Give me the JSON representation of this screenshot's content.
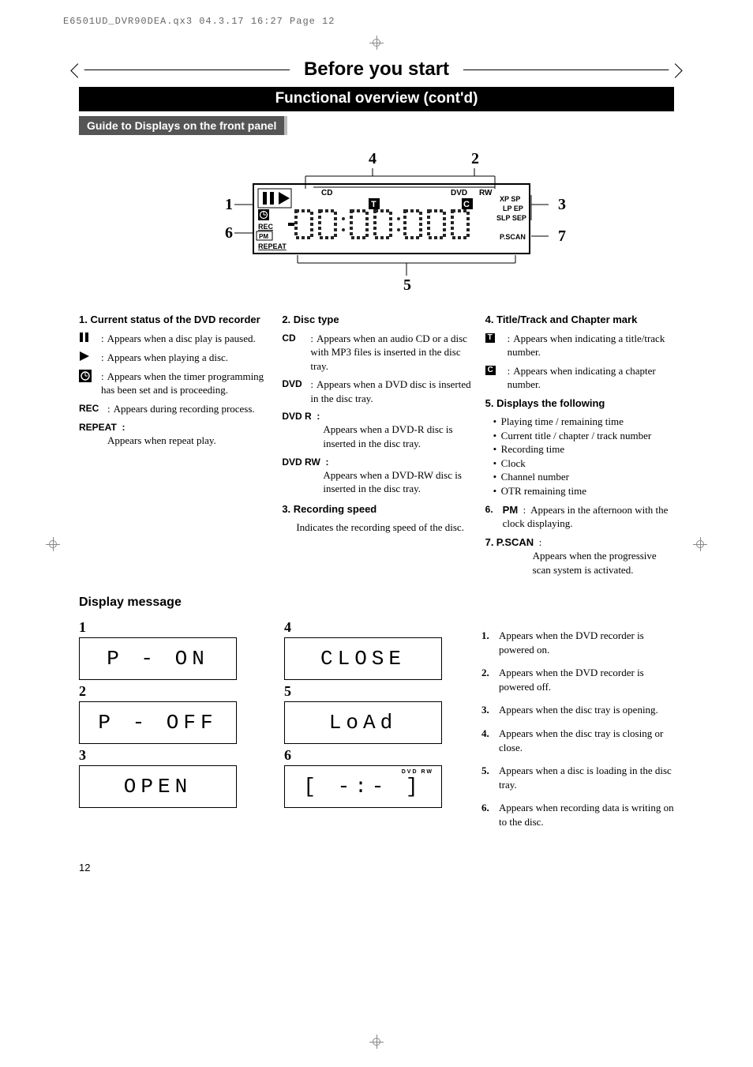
{
  "print_header": "E6501UD_DVR90DEA.qx3  04.3.17  16:27  Page 12",
  "title": "Before you start",
  "subtitle": "Functional overview (cont'd)",
  "guide_label": "Guide to Displays on the front panel",
  "diagram": {
    "labels": [
      "1",
      "2",
      "3",
      "4",
      "5",
      "6",
      "7"
    ],
    "text_top": [
      "CD",
      "DVD",
      "RW"
    ],
    "text_left": [
      "REC",
      "PM",
      "REPEAT"
    ],
    "text_right": [
      "XP SP",
      "LP EP",
      "SLP SEP",
      "P.SCAN"
    ],
    "badge_t": "T",
    "badge_c": "C"
  },
  "col1": {
    "heading": "1.  Current status of the DVD recorder",
    "items": [
      {
        "icon": "pause-icon",
        "text": "Appears when a disc play is paused."
      },
      {
        "icon": "play-icon",
        "text": "Appears when playing a disc."
      },
      {
        "icon": "timer-icon",
        "text": "Appears when the timer programming has been set and is proceeding."
      },
      {
        "icon": "REC",
        "text": "Appears during recording process."
      },
      {
        "icon": "REPEAT",
        "spacer": ":",
        "text": "Appears when repeat play."
      }
    ]
  },
  "col2": {
    "heading": "2.  Disc type",
    "items": [
      {
        "icon": "CD",
        "text": "Appears when an audio CD or a disc with MP3 files is inserted in the disc tray."
      },
      {
        "icon": "DVD",
        "text": "Appears when a DVD disc is inserted in the disc tray."
      },
      {
        "icon": "DVD   R",
        "text": "Appears when a DVD-R disc is inserted in the disc tray."
      },
      {
        "icon": "DVD   RW",
        "text": "Appears when a DVD-RW disc is inserted in the disc tray."
      }
    ],
    "heading2": "3.  Recording speed",
    "text2": "Indicates the recording speed of the disc."
  },
  "col3": {
    "heading4": "4.  Title/Track and Chapter mark",
    "items4": [
      {
        "icon": "T",
        "text": "Appears when indicating a title/track number."
      },
      {
        "icon": "C",
        "text": "Appears when indicating a chapter number."
      }
    ],
    "heading5": "5.  Displays the following",
    "bullets5": [
      "Playing time / remaining time",
      "Current title / chapter / track number",
      "Recording time",
      "Clock",
      "Channel number",
      "OTR remaining time"
    ],
    "item6_label": "6.",
    "item6_icon": "PM",
    "item6_text": "Appears in the afternoon with the clock displaying.",
    "item7_label": "7.",
    "item7_icon": "P.SCAN",
    "item7_text": "Appears when the progressive scan system is activated."
  },
  "display_msg_title": "Display message",
  "msg_left": [
    {
      "num": "1",
      "text": "P - ON"
    },
    {
      "num": "2",
      "text": "P - OFF"
    },
    {
      "num": "3",
      "text": "OPEN"
    }
  ],
  "msg_right": [
    {
      "num": "4",
      "text": "CLOSE"
    },
    {
      "num": "5",
      "text": "LoAd"
    },
    {
      "num": "6",
      "text": "[ -:- ]",
      "tiny": "DVD   RW"
    }
  ],
  "right_list": [
    {
      "num": "1.",
      "text": "Appears when the DVD recorder is powered on."
    },
    {
      "num": "2.",
      "text": "Appears when the DVD recorder is powered off."
    },
    {
      "num": "3.",
      "text": "Appears when the disc tray is opening."
    },
    {
      "num": "4.",
      "text": "Appears when the disc tray is closing or close."
    },
    {
      "num": "5.",
      "text": "Appears when a disc is loading in the disc tray."
    },
    {
      "num": "6.",
      "text": "Appears when recording data is writing on to the disc."
    }
  ],
  "page_number": "12"
}
